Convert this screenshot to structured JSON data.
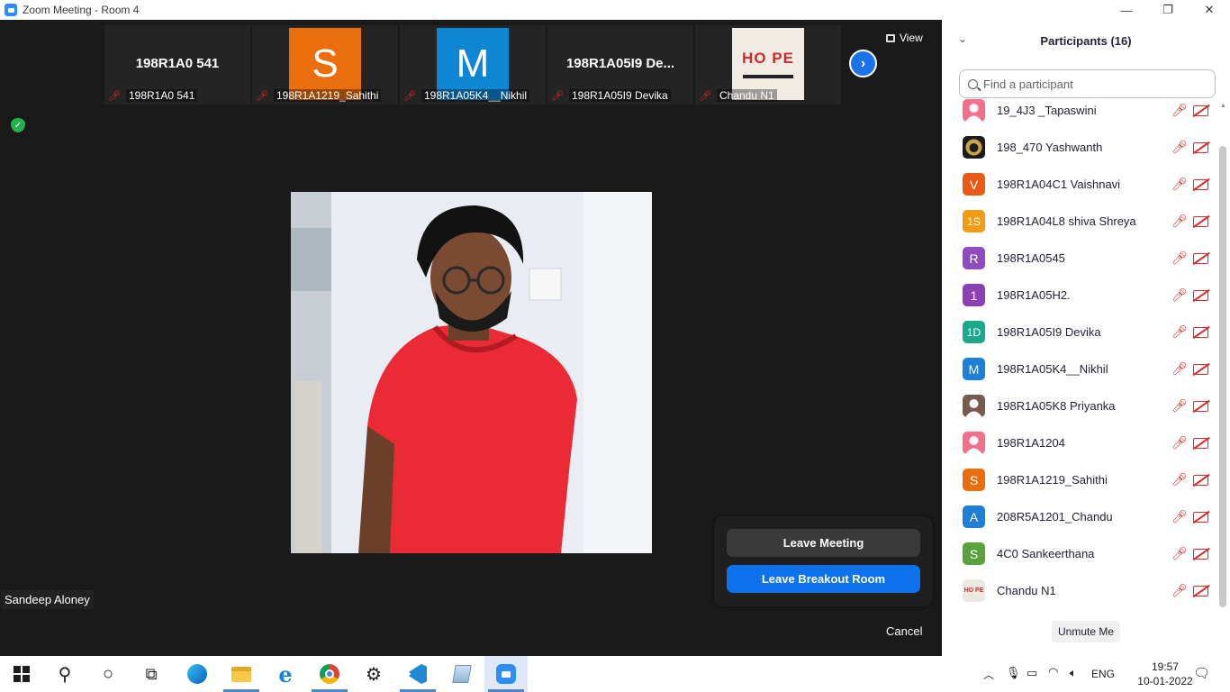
{
  "window": {
    "title": "Zoom Meeting - Room 4",
    "minimize": "—",
    "maximize": "❐",
    "close": "✕"
  },
  "thumbnails": [
    {
      "big_text": "198R1A0 541",
      "label": "198R1A0 541",
      "kind": "text"
    },
    {
      "avatar_letter": "S",
      "avatar_color": "#eb6e0d",
      "label": "198R1A1219_Sahithi",
      "kind": "avatar"
    },
    {
      "avatar_letter": "M",
      "avatar_color": "#0e86d4",
      "label": "198R1A05K4__Nikhil",
      "kind": "avatar"
    },
    {
      "big_text": "198R1A05I9 De...",
      "label": "198R1A05I9 Devika",
      "kind": "text"
    },
    {
      "image_text": "HO PE",
      "label": "Chandu N1",
      "kind": "image"
    }
  ],
  "view_button": "View",
  "speaker_name": "Sandeep Aloney",
  "leave": {
    "leave_meeting": "Leave Meeting",
    "leave_breakout": "Leave Breakout Room",
    "cancel": "Cancel"
  },
  "participants": {
    "title": "Participants (16)",
    "search_placeholder": "Find a participant",
    "unmute_button": "Unmute Me",
    "items": [
      {
        "name": "19_4J3 _Tapaswini",
        "avatar": "",
        "color": "#f36f8b",
        "avatar_kind": "person"
      },
      {
        "name": "198_470 Yashwanth",
        "avatar": "",
        "color": "#1c1c1c",
        "avatar_kind": "lion"
      },
      {
        "name": "198R1A04C1 Vaishnavi",
        "avatar": "V",
        "color": "#eb5a14",
        "avatar_kind": "letter"
      },
      {
        "name": "198R1A04L8 shiva Shreya",
        "avatar": "1S",
        "color": "#f29b14",
        "avatar_kind": "letter"
      },
      {
        "name": "198R1A0545",
        "avatar": "R",
        "color": "#8e4cbf",
        "avatar_kind": "letter"
      },
      {
        "name": "198R1A05H2.",
        "avatar": "1",
        "color": "#8e3fb5",
        "avatar_kind": "letter"
      },
      {
        "name": "198R1A05I9 Devika",
        "avatar": "1D",
        "color": "#1ea88a",
        "avatar_kind": "letter"
      },
      {
        "name": "198R1A05K4__Nikhil",
        "avatar": "M",
        "color": "#1f7fd6",
        "avatar_kind": "letter"
      },
      {
        "name": "198R1A05K8 Priyanka",
        "avatar": "",
        "color": "#7a5a4e",
        "avatar_kind": "person"
      },
      {
        "name": "198R1A1204",
        "avatar": "",
        "color": "#f36f8b",
        "avatar_kind": "person"
      },
      {
        "name": "198R1A1219_Sahithi",
        "avatar": "S",
        "color": "#eb6e0d",
        "avatar_kind": "letter"
      },
      {
        "name": "208R5A1201_Chandu",
        "avatar": "A",
        "color": "#1f7fd6",
        "avatar_kind": "letter"
      },
      {
        "name": "4C0 Sankeerthana",
        "avatar": "S",
        "color": "#5aa33a",
        "avatar_kind": "letter"
      },
      {
        "name": "Chandu N1",
        "avatar": "HO PE",
        "color": "#efe8e1",
        "avatar_kind": "image"
      }
    ]
  },
  "taskbar": {
    "language": "ENG",
    "time": "19:57",
    "date": "10-01-2022"
  },
  "colors": {
    "zoom_blue": "#0e72ed",
    "muted_red": "#e02828",
    "background": "#1a1a1a"
  }
}
